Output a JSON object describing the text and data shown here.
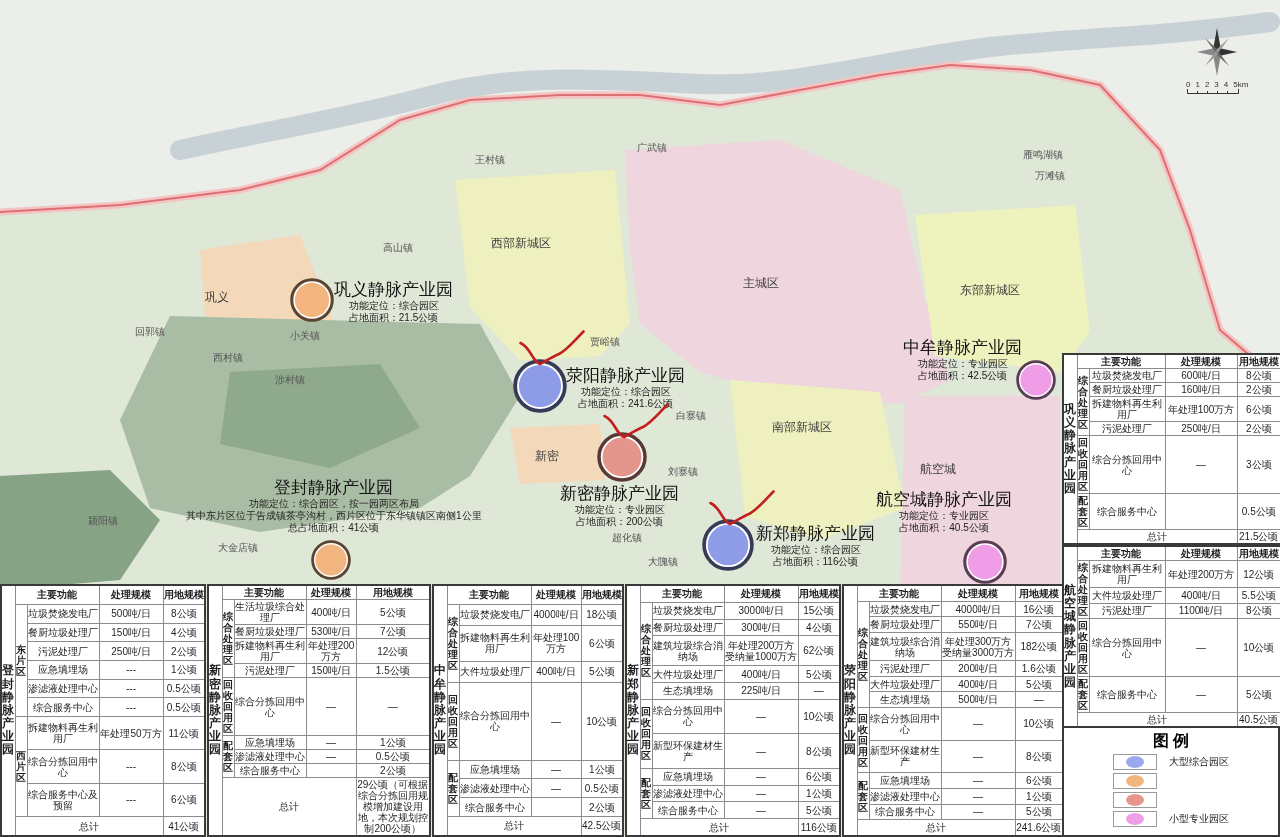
{
  "map": {
    "scale_bar": {
      "labels": [
        "0",
        "1",
        "2",
        "3",
        "4",
        "5km"
      ]
    },
    "labels": [
      {
        "text": "广武镇",
        "kind": "town"
      },
      {
        "text": "雁鸣湖镇",
        "kind": "town"
      },
      {
        "text": "王村镇",
        "kind": "town"
      },
      {
        "text": "万滩镇",
        "kind": "town"
      },
      {
        "text": "西部新城区",
        "kind": "district"
      },
      {
        "text": "高山镇",
        "kind": "town"
      },
      {
        "text": "主城区",
        "kind": "district"
      },
      {
        "text": "东部新城区",
        "kind": "district"
      },
      {
        "text": "巩义",
        "kind": "district"
      },
      {
        "text": "回郭镇",
        "kind": "town"
      },
      {
        "text": "小关镇",
        "kind": "town"
      },
      {
        "text": "贾峪镇",
        "kind": "town"
      },
      {
        "text": "西村镇",
        "kind": "town"
      },
      {
        "text": "涉村镇",
        "kind": "town"
      },
      {
        "text": "白寨镇",
        "kind": "town"
      },
      {
        "text": "南部新城区",
        "kind": "district"
      },
      {
        "text": "新密",
        "kind": "district"
      },
      {
        "text": "航空城",
        "kind": "district"
      },
      {
        "text": "刘寨镇",
        "kind": "town"
      },
      {
        "text": "颍阳镇",
        "kind": "town"
      },
      {
        "text": "超化镇",
        "kind": "town"
      },
      {
        "text": "大金店镇",
        "kind": "town"
      },
      {
        "text": "大隗镇",
        "kind": "town"
      }
    ],
    "parks": [
      {
        "name": "巩义静脉产业园",
        "lines": [
          "功能定位：综合园区",
          "占地面积：21.5公顷"
        ],
        "color": "#f3b57f",
        "marked": false
      },
      {
        "name": "中牟静脉产业园",
        "lines": [
          "功能定位：专业园区",
          "占地面积：42.5公顷"
        ],
        "color": "#ee9de6",
        "marked": false
      },
      {
        "name": "荥阳静脉产业园",
        "lines": [
          "功能定位：综合园区",
          "占地面积：241.6公顷"
        ],
        "color": "#8e9ce8",
        "marked": true
      },
      {
        "name": "登封静脉产业园",
        "lines": [
          "功能定位：综合园区，按一园两区布局",
          "其中东片区位于告成镇茶亭沟村，西片区位于东华镇镇区南侧1公里",
          "总占地面积：41公顷"
        ],
        "color": "#f3b57f",
        "marked": false
      },
      {
        "name": "新密静脉产业园",
        "lines": [
          "功能定位：专业园区",
          "占地面积：200公顷"
        ],
        "color": "#e5968c",
        "marked": true
      },
      {
        "name": "航空城静脉产业园",
        "lines": [
          "功能定位：专业园区",
          "占地面积：40.5公顷"
        ],
        "color": "#ee9de6",
        "marked": false
      },
      {
        "name": "新郑静脉产业园",
        "lines": [
          "功能定位：综合园区",
          "占地面积：116公顷"
        ],
        "color": "#8e9ce8",
        "marked": true
      }
    ]
  },
  "right_tables": [
    {
      "park": "巩义静脉产业园",
      "columns": [
        "主要功能",
        "处理规模",
        "用地规模"
      ],
      "groups": [
        {
          "label": "综合处理区",
          "rows": [
            {
              "function": "垃圾焚烧发电厂",
              "capacity": "600吨/日",
              "area": "8公顷"
            },
            {
              "function": "餐厨垃圾处理厂",
              "capacity": "160吨/日",
              "area": "2公顷"
            },
            {
              "function": "拆建物料再生利用厂",
              "capacity": "年处理100万方",
              "area": "6公顷"
            },
            {
              "function": "污泥处理厂",
              "capacity": "250吨/日",
              "area": "2公顷"
            }
          ]
        },
        {
          "label": "回收回用区",
          "rows": [
            {
              "function": "综合分拣回用中心",
              "capacity": "—",
              "area": "3公顷"
            }
          ]
        },
        {
          "label": "配套区",
          "rows": [
            {
              "function": "综合服务中心",
              "area": "0.5公顷"
            }
          ]
        }
      ],
      "total_label": "总计",
      "total": "21.5公顷"
    },
    {
      "park": "航空城静脉产业园",
      "columns": [
        "主要功能",
        "处理规模",
        "用地规模"
      ],
      "groups": [
        {
          "label": "综合处理区",
          "rows": [
            {
              "function": "拆建物料再生利用厂",
              "capacity": "年处理200万方",
              "area": "12公顷"
            },
            {
              "function": "大件垃圾处理厂",
              "capacity": "400吨/日",
              "area": "5.5公顷"
            },
            {
              "function": "污泥处理厂",
              "capacity": "1100吨/日",
              "area": "8公顷"
            }
          ]
        },
        {
          "label": "回收回用区",
          "rows": [
            {
              "function": "综合分拣回用中心",
              "capacity": "—",
              "area": "10公顷"
            }
          ]
        },
        {
          "label": "配套区",
          "rows": [
            {
              "function": "综合服务中心",
              "capacity": "—",
              "area": "5公顷"
            }
          ]
        }
      ],
      "total_label": "总计",
      "total": "40.5公顷"
    }
  ],
  "legend": {
    "title": "图 例",
    "items": [
      {
        "label": "大型综合园区",
        "color": "#9aa8ee"
      },
      {
        "color": "#f3b57f"
      },
      {
        "color": "#e5968c"
      },
      {
        "label": "小型专业园区",
        "color": "#ee9de6"
      }
    ]
  },
  "bottom_tables": [
    {
      "park": "登封静脉产业园",
      "columns": [
        "主要功能",
        "处理规模",
        "用地规模"
      ],
      "groups": [
        {
          "label": "东片区",
          "rows": [
            {
              "function": "垃圾焚烧发电厂",
              "capacity": "500吨/日",
              "area": "8公顷"
            },
            {
              "function": "餐厨垃圾处理厂",
              "capacity": "150吨/日",
              "area": "4公顷"
            },
            {
              "function": "污泥处理厂",
              "capacity": "250吨/日",
              "area": "2公顷"
            },
            {
              "function": "应急填埋场",
              "capacity": "---",
              "area": "1公顷"
            },
            {
              "function": "渗滤液处理中心",
              "capacity": "---",
              "area": "0.5公顷"
            },
            {
              "function": "综合服务中心",
              "capacity": "---",
              "area": "0.5公顷"
            }
          ]
        },
        {
          "label": "西片区",
          "rows": [
            {
              "function": "拆建物料再生利用厂",
              "capacity": "年处理50万方",
              "area": "11公顷"
            },
            {
              "function": "综合分拣回用中心",
              "capacity": "---",
              "area": "8公顷"
            },
            {
              "function": "综合服务中心及预留",
              "capacity": "---",
              "area": "6公顷"
            }
          ]
        }
      ],
      "total_label": "总计",
      "total": "41公顷"
    },
    {
      "park": "新密静脉产业园",
      "columns": [
        "主要功能",
        "处理规模",
        "用地规模"
      ],
      "groups": [
        {
          "label": "综合处理区",
          "rows": [
            {
              "function": "生活垃圾综合处理厂",
              "capacity": "400吨/日",
              "area": "5公顷"
            },
            {
              "function": "餐厨垃圾处理厂",
              "capacity": "530吨/日",
              "area": "7公顷"
            },
            {
              "function": "拆建物料再生利用厂",
              "capacity": "年处理200万方",
              "area": "12公顷"
            },
            {
              "function": "污泥处理厂",
              "capacity": "150吨/日",
              "area": "1.5公顷"
            }
          ]
        },
        {
          "label": "回收回用区",
          "rows": [
            {
              "function": "综合分拣回用中心",
              "capacity": "—",
              "area": "—"
            }
          ]
        },
        {
          "label": "配套区",
          "rows": [
            {
              "function": "应急填埋场",
              "capacity": "—",
              "area": "1公顷"
            },
            {
              "function": "渗滤液处理中心",
              "capacity": "—",
              "area": "0.5公顷"
            },
            {
              "function": "综合服务中心",
              "area": "2公顷"
            }
          ]
        }
      ],
      "total_label": "总计",
      "total": "29公顷（可根据综合分拣回用规模增加建设用地，本次规划控制200公顷）"
    },
    {
      "park": "中牟静脉产业园",
      "columns": [
        "主要功能",
        "处理规模",
        "用地规模"
      ],
      "groups": [
        {
          "label": "综合处理区",
          "rows": [
            {
              "function": "垃圾焚烧发电厂",
              "capacity": "4000吨/日",
              "area": "18公顷"
            },
            {
              "function": "拆建物料再生利用厂",
              "capacity": "年处理100万方",
              "area": "6公顷"
            },
            {
              "function": "大件垃圾处理厂",
              "capacity": "400吨/日",
              "area": "5公顷"
            }
          ]
        },
        {
          "label": "回收回用区",
          "rows": [
            {
              "function": "综合分拣回用中心",
              "capacity": "—",
              "area": "10公顷"
            }
          ]
        },
        {
          "label": "配套区",
          "rows": [
            {
              "function": "应急填埋场",
              "capacity": "—",
              "area": "1公顷"
            },
            {
              "function": "渗滤液处理中心",
              "capacity": "—",
              "area": "0.5公顷"
            },
            {
              "function": "综合服务中心",
              "area": "2公顷"
            }
          ]
        }
      ],
      "total_label": "总计",
      "total": "42.5公顷"
    },
    {
      "park": "新郑静脉产业园",
      "columns": [
        "主要功能",
        "处理规模",
        "用地规模"
      ],
      "groups": [
        {
          "label": "综合处理区",
          "rows": [
            {
              "function": "垃圾焚烧发电厂",
              "capacity": "3000吨/日",
              "area": "15公顷"
            },
            {
              "function": "餐厨垃圾处理厂",
              "capacity": "300吨/日",
              "area": "4公顷"
            },
            {
              "function": "建筑垃圾综合消纳场",
              "capacity": "年处理200万方受纳量1000万方",
              "area": "62公顷"
            },
            {
              "function": "大件垃圾处理厂",
              "capacity": "400吨/日",
              "area": "5公顷"
            },
            {
              "function": "生态填埋场",
              "capacity": "225吨/日",
              "area": "—"
            }
          ]
        },
        {
          "label": "回收回用区",
          "rows": [
            {
              "function": "综合分拣回用中心",
              "capacity": "—",
              "area": "10公顷"
            },
            {
              "function": "新型环保建材生产",
              "capacity": "—",
              "area": "8公顷"
            }
          ]
        },
        {
          "label": "配套区",
          "rows": [
            {
              "function": "应急填埋场",
              "capacity": "—",
              "area": "6公顷"
            },
            {
              "function": "渗滤液处理中心",
              "capacity": "—",
              "area": "1公顷"
            },
            {
              "function": "综合服务中心",
              "capacity": "—",
              "area": "5公顷"
            }
          ]
        }
      ],
      "total_label": "总计",
      "total": "116公顷"
    },
    {
      "park": "荥阳静脉产业园",
      "columns": [
        "主要功能",
        "处理规模",
        "用地规模"
      ],
      "groups": [
        {
          "label": "综合处理区",
          "rows": [
            {
              "function": "垃圾焚烧发电厂",
              "capacity": "4000吨/日",
              "area": "16公顷"
            },
            {
              "function": "餐厨垃圾处理厂",
              "capacity": "550吨/日",
              "area": "7公顷"
            },
            {
              "function": "建筑垃圾综合消纳场",
              "capacity": "年处理300万方受纳量3000万方",
              "area": "182公顷"
            },
            {
              "function": "污泥处理厂",
              "capacity": "200吨/日",
              "area": "1.6公顷"
            },
            {
              "function": "大件垃圾处理厂",
              "capacity": "400吨/日",
              "area": "5公顷"
            },
            {
              "function": "生态填埋场",
              "capacity": "500吨/日",
              "area": "—"
            }
          ]
        },
        {
          "label": "回收回用区",
          "rows": [
            {
              "function": "综合分拣回用中心",
              "capacity": "—",
              "area": "10公顷"
            },
            {
              "function": "新型环保建材生产",
              "capacity": "—",
              "area": "8公顷"
            }
          ]
        },
        {
          "label": "配套区",
          "rows": [
            {
              "function": "应急填埋场",
              "capacity": "—",
              "area": "6公顷"
            },
            {
              "function": "渗滤液处理中心",
              "capacity": "—",
              "area": "1公顷"
            },
            {
              "function": "综合服务中心",
              "capacity": "—",
              "area": "5公顷"
            }
          ]
        }
      ],
      "total_label": "总计",
      "total": "241.6公顷"
    }
  ]
}
